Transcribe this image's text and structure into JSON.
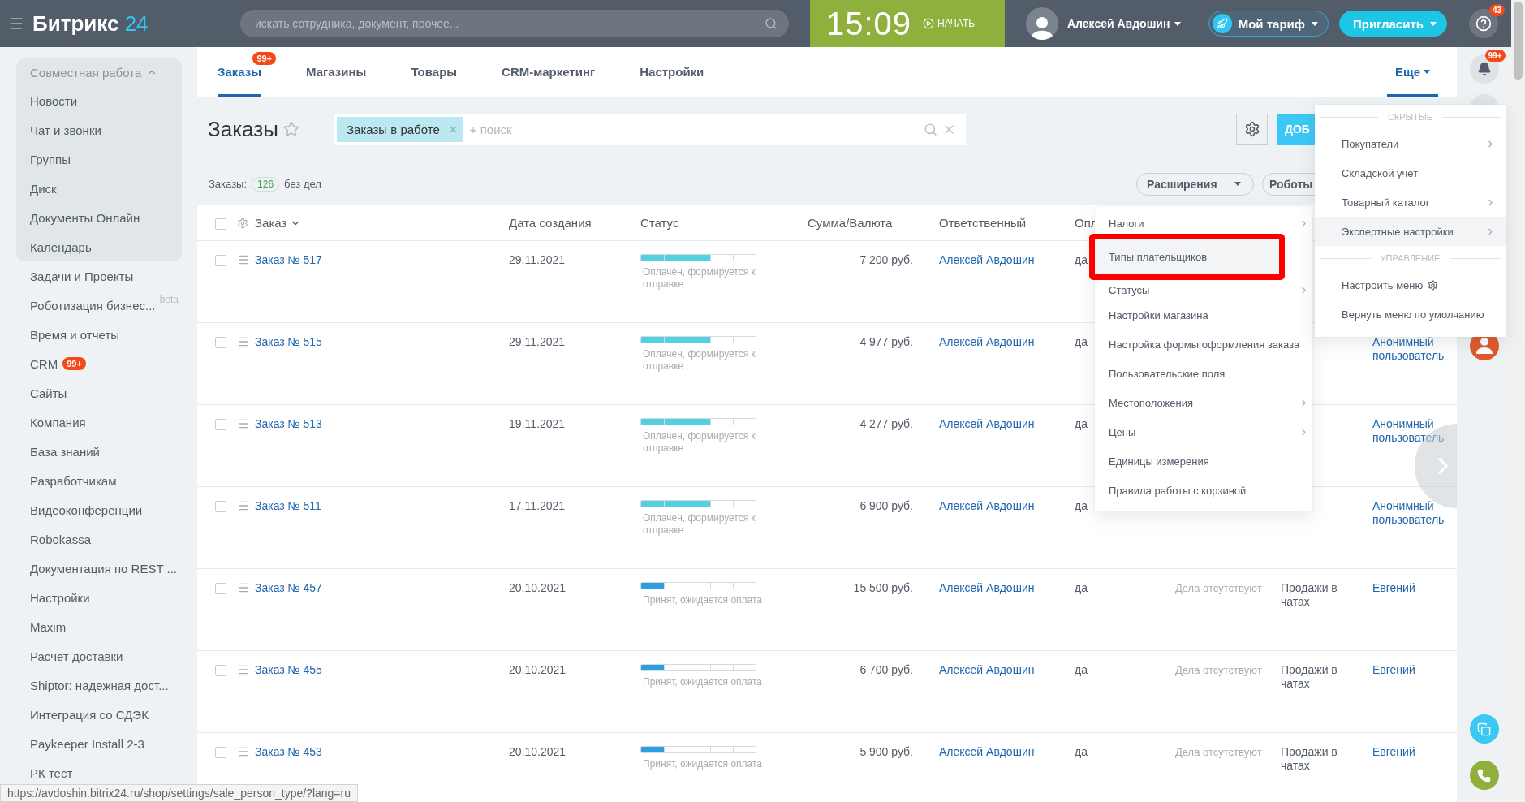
{
  "topbar": {
    "logo": {
      "name": "Битрикс",
      "suffix": "24"
    },
    "search": {
      "placeholder": "искать сотрудника, документ, прочее..."
    },
    "clock": {
      "time": "15:09",
      "action": "НАЧАТЬ"
    },
    "user": {
      "name": "Алексей Авдошин"
    },
    "buttons": [
      {
        "label": "Мой тариф",
        "kind": "outline"
      },
      {
        "label": "Пригласить",
        "kind": "primary"
      }
    ],
    "help": {
      "badge": "43"
    }
  },
  "sidebar": {
    "group": {
      "title": "Совместная работа",
      "expanded": true,
      "items": [
        {
          "label": "Новости"
        },
        {
          "label": "Чат и звонки"
        },
        {
          "label": "Группы"
        },
        {
          "label": "Диск"
        },
        {
          "label": "Документы Онлайн"
        },
        {
          "label": "Календарь"
        }
      ]
    },
    "items": [
      {
        "label": "Задачи и Проекты"
      },
      {
        "label": "Роботизация бизнес...",
        "tag": "beta"
      },
      {
        "label": "Время и отчеты"
      },
      {
        "label": "CRM",
        "badge": "99+"
      },
      {
        "label": "Сайты"
      },
      {
        "label": "Компания"
      },
      {
        "label": "База знаний"
      },
      {
        "label": "Разработчикам"
      },
      {
        "label": "Видеоконференции"
      },
      {
        "label": "Robokassa"
      },
      {
        "label": "Документация по REST ..."
      },
      {
        "label": "Настройки"
      },
      {
        "label": "Maxim"
      },
      {
        "label": "Расчет доставки"
      },
      {
        "label": "Shiptor: надежная дост..."
      },
      {
        "label": "Интеграция со СДЭК"
      },
      {
        "label": "Paykeeper Install 2-3"
      },
      {
        "label": "РК тест"
      }
    ]
  },
  "tabs": [
    {
      "label": "Заказы",
      "selected": true,
      "badge": "99+"
    },
    {
      "label": "Магазины",
      "selected": false
    },
    {
      "label": "Товары",
      "selected": false
    },
    {
      "label": "CRM-маркетинг",
      "selected": false
    },
    {
      "label": "Настройки",
      "selected": false
    }
  ],
  "more_tab": {
    "label": "Еще",
    "open": true
  },
  "page": {
    "title": "Заказы",
    "filter": {
      "tag": "Заказы в работе",
      "placeholder": "+ поиск"
    },
    "add_button": "ДОБ",
    "counter": {
      "label": "Заказы:",
      "count": "126",
      "note": "без дел"
    },
    "toolbar_buttons": [
      {
        "label": "Расширения",
        "kind": "split"
      },
      {
        "label": "Роботы",
        "kind": "plain"
      }
    ]
  },
  "table": {
    "all_checked": false,
    "columns": [
      "Заказ",
      "Дата создания",
      "Статус",
      "Сумма/Валюта",
      "Ответственный",
      "Опл"
    ],
    "rows": [
      {
        "checked": false,
        "order": "Заказ № 517",
        "date": "29.11.2021",
        "status": {
          "label": "Оплачен, формируется к отправке",
          "level": 0.6,
          "color": "#55d0e0"
        },
        "sum": "7 200 руб.",
        "responsible": "Алексей Авдошин",
        "paid": "да"
      },
      {
        "checked": false,
        "order": "Заказ № 515",
        "date": "29.11.2021",
        "status": {
          "label": "Оплачен, формируется к отправке",
          "level": 0.6,
          "color": "#55d0e0"
        },
        "sum": "4 977 руб.",
        "responsible": "Алексей Авдошин",
        "paid": "да",
        "buyer": "Анонимный пользователь"
      },
      {
        "checked": false,
        "order": "Заказ № 513",
        "date": "19.11.2021",
        "status": {
          "label": "Оплачен, формируется к отправке",
          "level": 0.6,
          "color": "#55d0e0"
        },
        "sum": "4 277 руб.",
        "responsible": "Алексей Авдошин",
        "paid": "да",
        "buyer": "Анонимный пользователь"
      },
      {
        "checked": false,
        "order": "Заказ № 511",
        "date": "17.11.2021",
        "status": {
          "label": "Оплачен, формируется к отправке",
          "level": 0.6,
          "color": "#55d0e0"
        },
        "sum": "6 900 руб.",
        "responsible": "Алексей Авдошин",
        "paid": "да",
        "buyer": "Анонимный пользователь"
      },
      {
        "checked": false,
        "order": "Заказ № 457",
        "date": "20.10.2021",
        "status": {
          "label": "Принят, ожидается оплата",
          "level": 0.2,
          "color": "#2d9ee0"
        },
        "sum": "15 500 руб.",
        "responsible": "Алексей Авдошин",
        "paid": "да",
        "deals": "Дела отсутствуют",
        "channel": "Продажи в чатах",
        "buyer": "Евгений"
      },
      {
        "checked": false,
        "order": "Заказ № 455",
        "date": "20.10.2021",
        "status": {
          "label": "Принят, ожидается оплата",
          "level": 0.2,
          "color": "#2d9ee0"
        },
        "sum": "6 700 руб.",
        "responsible": "Алексей Авдошин",
        "paid": "да",
        "deals": "Дела отсутствуют",
        "channel": "Продажи в чатах",
        "buyer": "Евгений"
      },
      {
        "checked": false,
        "order": "Заказ № 453",
        "date": "20.10.2021",
        "status": {
          "label": "Принят, ожидается оплата",
          "level": 0.2,
          "color": "#2d9ee0"
        },
        "sum": "5 900 руб.",
        "responsible": "Алексей Авдошин",
        "paid": "да",
        "deals": "Дела отсутствуют",
        "channel": "Продажи в чатах",
        "buyer": "Евгений"
      }
    ]
  },
  "settings_menu": {
    "items": [
      {
        "label": "Налоги",
        "submenu": true,
        "highlighted": false,
        "marked": false
      },
      {
        "label": "Типы плательщиков",
        "submenu": false,
        "highlighted": true,
        "marked": true
      },
      {
        "label": "Статусы",
        "submenu": true,
        "highlighted": false,
        "marked": false
      },
      {
        "label": "Настройки магазина",
        "submenu": false,
        "highlighted": false,
        "marked": false
      },
      {
        "label": "Настройка формы оформления заказа",
        "submenu": false,
        "highlighted": false,
        "marked": false
      },
      {
        "label": "Пользовательские поля",
        "submenu": false,
        "highlighted": false,
        "marked": false
      },
      {
        "label": "Местоположения",
        "submenu": true,
        "highlighted": false,
        "marked": false
      },
      {
        "label": "Цены",
        "submenu": true,
        "highlighted": false,
        "marked": false
      },
      {
        "label": "Единицы измерения",
        "submenu": false,
        "highlighted": false,
        "marked": false
      },
      {
        "label": "Правила работы с корзиной",
        "submenu": false,
        "highlighted": false,
        "marked": false
      }
    ]
  },
  "more_menu": {
    "sections": [
      {
        "title": "СКРЫТЫЕ",
        "items": [
          {
            "label": "Покупатели",
            "kind": "link",
            "submenu": true,
            "highlighted": false
          },
          {
            "label": "Складской учет",
            "kind": "link",
            "submenu": false,
            "highlighted": false
          },
          {
            "label": "Товарный каталог",
            "kind": "link",
            "submenu": true,
            "highlighted": false
          },
          {
            "label": "Экспертные настройки",
            "kind": "link",
            "submenu": true,
            "highlighted": true
          }
        ]
      },
      {
        "title": "УПРАВЛЕНИЕ",
        "items": [
          {
            "label": "Настроить меню",
            "kind": "settings",
            "submenu": false,
            "highlighted": false
          },
          {
            "label": "Вернуть меню по умолчанию",
            "kind": "link",
            "submenu": false,
            "highlighted": false
          }
        ]
      }
    ]
  },
  "rail": {
    "notifications_badge": "99+"
  },
  "status_url": "https://avdoshin.bitrix24.ru/shop/settings/sale_person_type/?lang=ru"
}
